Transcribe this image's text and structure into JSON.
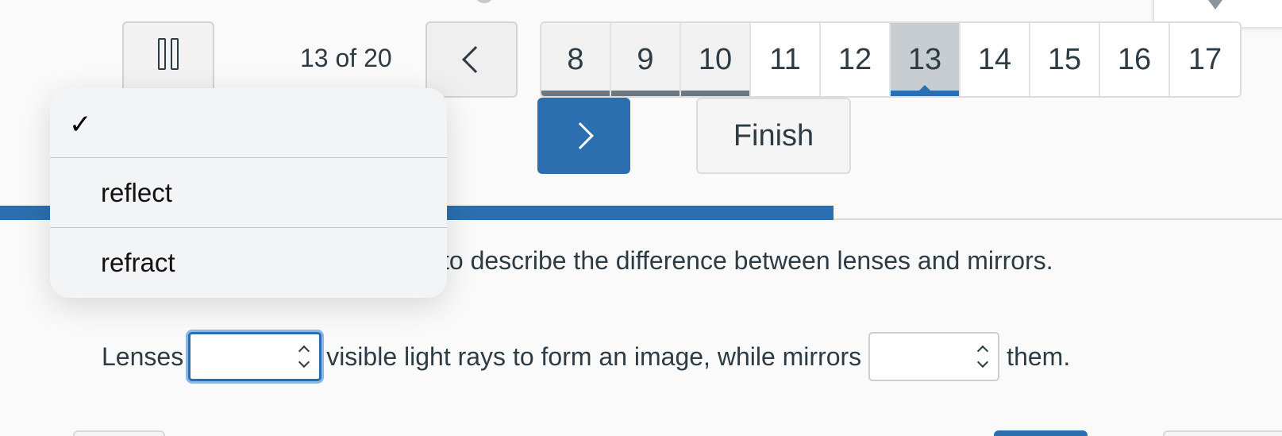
{
  "nav": {
    "counter": "13 of 20",
    "pages": [
      "8",
      "9",
      "10",
      "11",
      "12",
      "13",
      "14",
      "15",
      "16",
      "17"
    ],
    "visited_pages": [
      "8",
      "9",
      "10"
    ],
    "current_page": "13",
    "finish_label": "Finish"
  },
  "progress": {
    "fraction": 0.65
  },
  "question": {
    "instructions": "to describe the difference between lenses and mirrors.",
    "part_lenses": "Lenses",
    "part_middle": "visible light rays to form an image, while mirrors",
    "part_end": "them."
  },
  "dropdown": {
    "selected": "",
    "options": [
      "",
      "reflect",
      "refract"
    ]
  },
  "colors": {
    "accent": "#2b6fb0",
    "visited_marker": "#6b7780",
    "current_bg": "#c7cdd1",
    "focus_ring": "#8db7e4"
  },
  "icons": {
    "pause": "pause-icon",
    "prev": "chevron-left-icon",
    "next": "chevron-right-icon",
    "select": "updown-chevron-icon",
    "check": "checkmark-icon"
  }
}
